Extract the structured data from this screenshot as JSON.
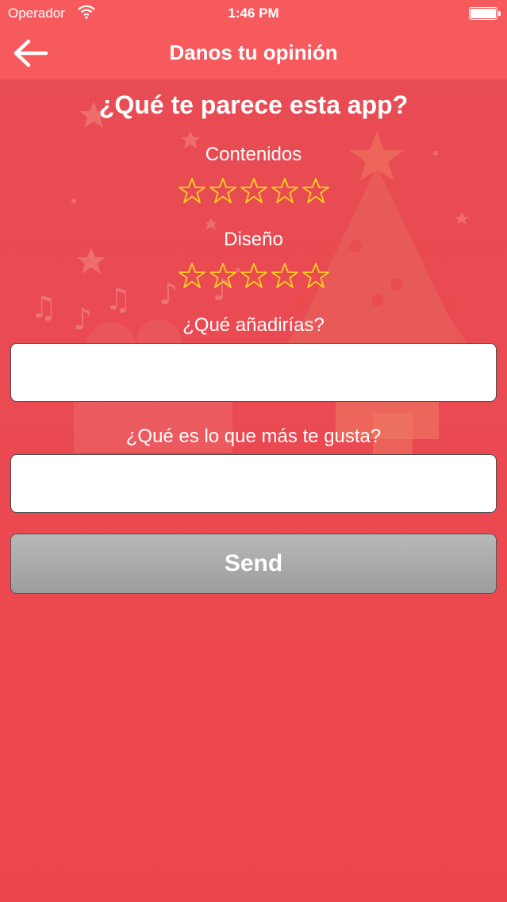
{
  "status_bar": {
    "carrier": "Operador",
    "time": "1:46 PM",
    "battery_level": 1.0
  },
  "nav": {
    "title": "Danos tu opinión",
    "back_icon": "arrow-left-icon"
  },
  "form": {
    "heading": "¿Qué te parece esta app?",
    "ratings": [
      {
        "label": "Contenidos",
        "stars_total": 5,
        "stars_filled": 0
      },
      {
        "label": "Diseño",
        "stars_total": 5,
        "stars_filled": 0
      }
    ],
    "add_label": "¿Qué añadirías?",
    "add_value": "",
    "like_label": "¿Qué es lo que más te gusta?",
    "like_value": "",
    "send_label": "Send"
  },
  "colors": {
    "accent": "#f75a5c",
    "star": "#f6d11e",
    "button": "#a9a9a9"
  }
}
